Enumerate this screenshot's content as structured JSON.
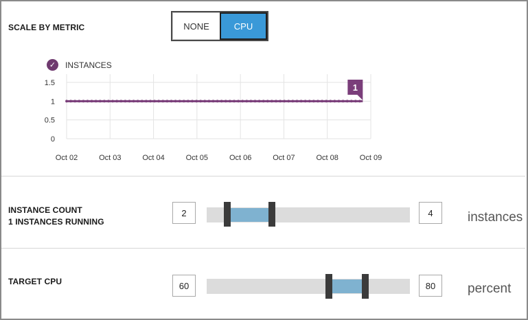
{
  "scale_by_metric": {
    "label": "SCALE BY METRIC",
    "options": [
      "NONE",
      "CPU"
    ],
    "selected": "CPU"
  },
  "chart_data": {
    "type": "line",
    "legend": "INSTANCES",
    "x_ticks": [
      "Oct 02",
      "Oct 03",
      "Oct 04",
      "Oct 05",
      "Oct 06",
      "Oct 07",
      "Oct 08",
      "Oct 09"
    ],
    "y_ticks": [
      "1.5",
      "1",
      "0.5",
      "0"
    ],
    "ylim": [
      0,
      1.5
    ],
    "grid": true,
    "series": [
      {
        "name": "INSTANCES",
        "x": [
          "Oct 02",
          "Oct 09"
        ],
        "values": [
          1,
          1
        ]
      }
    ],
    "annotation": "1",
    "colors": {
      "series": "#7a3e7a",
      "grid": "#e3e3e3"
    }
  },
  "instance_count": {
    "label_line1": "INSTANCE COUNT",
    "label_line2": "1 INSTANCES RUNNING",
    "min": "2",
    "max": "4",
    "unit": "instances",
    "range_fraction": [
      0.1,
      0.32
    ]
  },
  "target_cpu": {
    "label": "TARGET CPU",
    "min": "60",
    "max": "80",
    "unit": "percent",
    "range_fraction": [
      0.6,
      0.78
    ]
  },
  "colors": {
    "accent": "#3a99d8",
    "handle": "#3b3b3b",
    "range_fill": "#7fb2d0",
    "track": "#dcdcdc"
  }
}
